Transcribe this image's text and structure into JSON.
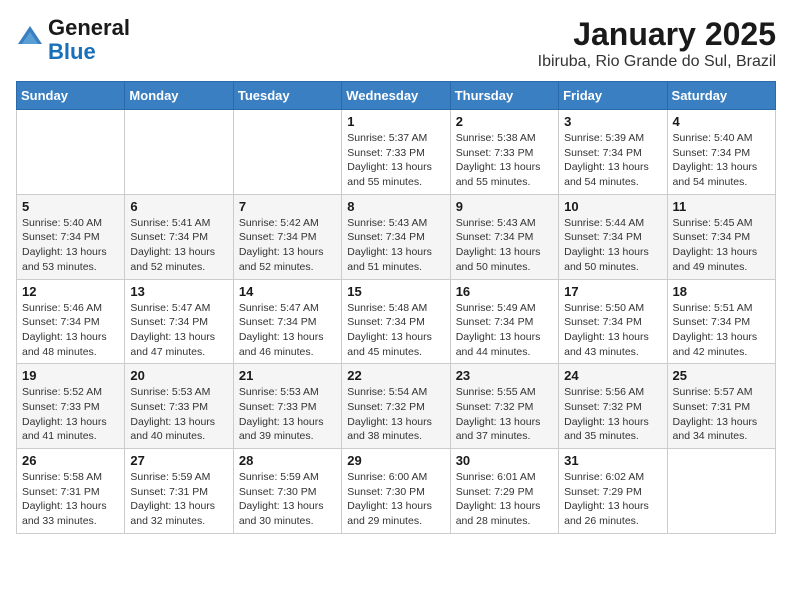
{
  "header": {
    "logo_line1": "General",
    "logo_line2": "Blue",
    "title": "January 2025",
    "subtitle": "Ibiruba, Rio Grande do Sul, Brazil"
  },
  "calendar": {
    "weekdays": [
      "Sunday",
      "Monday",
      "Tuesday",
      "Wednesday",
      "Thursday",
      "Friday",
      "Saturday"
    ],
    "weeks": [
      [
        {
          "day": "",
          "sunrise": "",
          "sunset": "",
          "daylight": ""
        },
        {
          "day": "",
          "sunrise": "",
          "sunset": "",
          "daylight": ""
        },
        {
          "day": "",
          "sunrise": "",
          "sunset": "",
          "daylight": ""
        },
        {
          "day": "1",
          "sunrise": "Sunrise: 5:37 AM",
          "sunset": "Sunset: 7:33 PM",
          "daylight": "Daylight: 13 hours and 55 minutes."
        },
        {
          "day": "2",
          "sunrise": "Sunrise: 5:38 AM",
          "sunset": "Sunset: 7:33 PM",
          "daylight": "Daylight: 13 hours and 55 minutes."
        },
        {
          "day": "3",
          "sunrise": "Sunrise: 5:39 AM",
          "sunset": "Sunset: 7:34 PM",
          "daylight": "Daylight: 13 hours and 54 minutes."
        },
        {
          "day": "4",
          "sunrise": "Sunrise: 5:40 AM",
          "sunset": "Sunset: 7:34 PM",
          "daylight": "Daylight: 13 hours and 54 minutes."
        }
      ],
      [
        {
          "day": "5",
          "sunrise": "Sunrise: 5:40 AM",
          "sunset": "Sunset: 7:34 PM",
          "daylight": "Daylight: 13 hours and 53 minutes."
        },
        {
          "day": "6",
          "sunrise": "Sunrise: 5:41 AM",
          "sunset": "Sunset: 7:34 PM",
          "daylight": "Daylight: 13 hours and 52 minutes."
        },
        {
          "day": "7",
          "sunrise": "Sunrise: 5:42 AM",
          "sunset": "Sunset: 7:34 PM",
          "daylight": "Daylight: 13 hours and 52 minutes."
        },
        {
          "day": "8",
          "sunrise": "Sunrise: 5:43 AM",
          "sunset": "Sunset: 7:34 PM",
          "daylight": "Daylight: 13 hours and 51 minutes."
        },
        {
          "day": "9",
          "sunrise": "Sunrise: 5:43 AM",
          "sunset": "Sunset: 7:34 PM",
          "daylight": "Daylight: 13 hours and 50 minutes."
        },
        {
          "day": "10",
          "sunrise": "Sunrise: 5:44 AM",
          "sunset": "Sunset: 7:34 PM",
          "daylight": "Daylight: 13 hours and 50 minutes."
        },
        {
          "day": "11",
          "sunrise": "Sunrise: 5:45 AM",
          "sunset": "Sunset: 7:34 PM",
          "daylight": "Daylight: 13 hours and 49 minutes."
        }
      ],
      [
        {
          "day": "12",
          "sunrise": "Sunrise: 5:46 AM",
          "sunset": "Sunset: 7:34 PM",
          "daylight": "Daylight: 13 hours and 48 minutes."
        },
        {
          "day": "13",
          "sunrise": "Sunrise: 5:47 AM",
          "sunset": "Sunset: 7:34 PM",
          "daylight": "Daylight: 13 hours and 47 minutes."
        },
        {
          "day": "14",
          "sunrise": "Sunrise: 5:47 AM",
          "sunset": "Sunset: 7:34 PM",
          "daylight": "Daylight: 13 hours and 46 minutes."
        },
        {
          "day": "15",
          "sunrise": "Sunrise: 5:48 AM",
          "sunset": "Sunset: 7:34 PM",
          "daylight": "Daylight: 13 hours and 45 minutes."
        },
        {
          "day": "16",
          "sunrise": "Sunrise: 5:49 AM",
          "sunset": "Sunset: 7:34 PM",
          "daylight": "Daylight: 13 hours and 44 minutes."
        },
        {
          "day": "17",
          "sunrise": "Sunrise: 5:50 AM",
          "sunset": "Sunset: 7:34 PM",
          "daylight": "Daylight: 13 hours and 43 minutes."
        },
        {
          "day": "18",
          "sunrise": "Sunrise: 5:51 AM",
          "sunset": "Sunset: 7:34 PM",
          "daylight": "Daylight: 13 hours and 42 minutes."
        }
      ],
      [
        {
          "day": "19",
          "sunrise": "Sunrise: 5:52 AM",
          "sunset": "Sunset: 7:33 PM",
          "daylight": "Daylight: 13 hours and 41 minutes."
        },
        {
          "day": "20",
          "sunrise": "Sunrise: 5:53 AM",
          "sunset": "Sunset: 7:33 PM",
          "daylight": "Daylight: 13 hours and 40 minutes."
        },
        {
          "day": "21",
          "sunrise": "Sunrise: 5:53 AM",
          "sunset": "Sunset: 7:33 PM",
          "daylight": "Daylight: 13 hours and 39 minutes."
        },
        {
          "day": "22",
          "sunrise": "Sunrise: 5:54 AM",
          "sunset": "Sunset: 7:32 PM",
          "daylight": "Daylight: 13 hours and 38 minutes."
        },
        {
          "day": "23",
          "sunrise": "Sunrise: 5:55 AM",
          "sunset": "Sunset: 7:32 PM",
          "daylight": "Daylight: 13 hours and 37 minutes."
        },
        {
          "day": "24",
          "sunrise": "Sunrise: 5:56 AM",
          "sunset": "Sunset: 7:32 PM",
          "daylight": "Daylight: 13 hours and 35 minutes."
        },
        {
          "day": "25",
          "sunrise": "Sunrise: 5:57 AM",
          "sunset": "Sunset: 7:31 PM",
          "daylight": "Daylight: 13 hours and 34 minutes."
        }
      ],
      [
        {
          "day": "26",
          "sunrise": "Sunrise: 5:58 AM",
          "sunset": "Sunset: 7:31 PM",
          "daylight": "Daylight: 13 hours and 33 minutes."
        },
        {
          "day": "27",
          "sunrise": "Sunrise: 5:59 AM",
          "sunset": "Sunset: 7:31 PM",
          "daylight": "Daylight: 13 hours and 32 minutes."
        },
        {
          "day": "28",
          "sunrise": "Sunrise: 5:59 AM",
          "sunset": "Sunset: 7:30 PM",
          "daylight": "Daylight: 13 hours and 30 minutes."
        },
        {
          "day": "29",
          "sunrise": "Sunrise: 6:00 AM",
          "sunset": "Sunset: 7:30 PM",
          "daylight": "Daylight: 13 hours and 29 minutes."
        },
        {
          "day": "30",
          "sunrise": "Sunrise: 6:01 AM",
          "sunset": "Sunset: 7:29 PM",
          "daylight": "Daylight: 13 hours and 28 minutes."
        },
        {
          "day": "31",
          "sunrise": "Sunrise: 6:02 AM",
          "sunset": "Sunset: 7:29 PM",
          "daylight": "Daylight: 13 hours and 26 minutes."
        },
        {
          "day": "",
          "sunrise": "",
          "sunset": "",
          "daylight": ""
        }
      ]
    ]
  }
}
